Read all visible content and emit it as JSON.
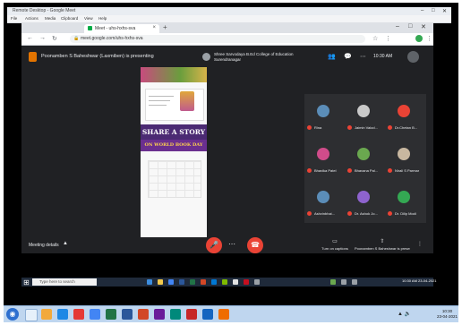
{
  "remote_window": {
    "title": "Remote Desktop - Google Meet",
    "menu": [
      "File",
      "Actions",
      "Media",
      "Clipboard",
      "View",
      "Help"
    ],
    "controls": [
      "–",
      "□",
      "✕"
    ]
  },
  "browser": {
    "tab": {
      "label": "Meet - uhs-hxhs-sva",
      "favicon": "meet-icon",
      "close": "×"
    },
    "new_tab": "+",
    "window_controls": [
      "–",
      "□",
      "✕"
    ],
    "nav": {
      "back": "←",
      "forward": "→",
      "reload": "↻"
    },
    "lock": "🔒",
    "url": "meet.google.com/uhs-hxhs-sva",
    "ext": {
      "star": "☆",
      "puzzle": "⋮",
      "menu": "⋮"
    },
    "profile_color": "#34a853"
  },
  "meet": {
    "presenting_text": "Poonamben S Baheshwar (Laxmiben) is presenting",
    "pinned_name": "Shree Sarvodaya B.Ed College of Education Surendranagar",
    "time": "10:30 AM",
    "header_icons": {
      "people": "👥",
      "chat": "💬",
      "activities": "⋯"
    }
  },
  "presentation": {
    "banner": "SHARE A STORY",
    "banner2": "ON WORLD BOOK DAY"
  },
  "participants": [
    {
      "name": "Rina",
      "color": "#5b8db8"
    },
    {
      "name": "Jaimin Valod...",
      "color": "#c9c9c9"
    },
    {
      "name": "Dr.Chetan B...",
      "color": "#ea4335"
    },
    {
      "name": "Bhavika Patel",
      "color": "#d04c8a"
    },
    {
      "name": "Bhavana Pal...",
      "color": "#6aa84f"
    },
    {
      "name": "Nirali S Parmar",
      "color": "#c8b7a0"
    },
    {
      "name": "Ashvinbhai...",
      "color": "#5b8db8"
    },
    {
      "name": "Dr. Ashok Jo...",
      "color": "#8e63ce"
    },
    {
      "name": "Dr. Dilip Modi",
      "color": "#34a853"
    }
  ],
  "bottom": {
    "details": "Meeting details",
    "chevron": "▲",
    "mic_icon": "🎤",
    "end_call_icon": "☎",
    "more_icon": "⋯",
    "cc_icon": "▭",
    "cc_label": "Turn on captions",
    "present_icon": "⇧",
    "present_label": "Poonamben S Baheshwar is presenting",
    "extra_icon": "⋮"
  },
  "remote_taskbar": {
    "start": "⊞",
    "search": "Type here to search",
    "clock": "10:30 AM 23-04-2021"
  },
  "host_taskbar": {
    "start": "◉",
    "tray": "▲ 🔈",
    "time": "10:30",
    "date": "23-04-2021"
  },
  "colors": {
    "accent_red": "#ea4335",
    "meet_bg": "#202124"
  }
}
